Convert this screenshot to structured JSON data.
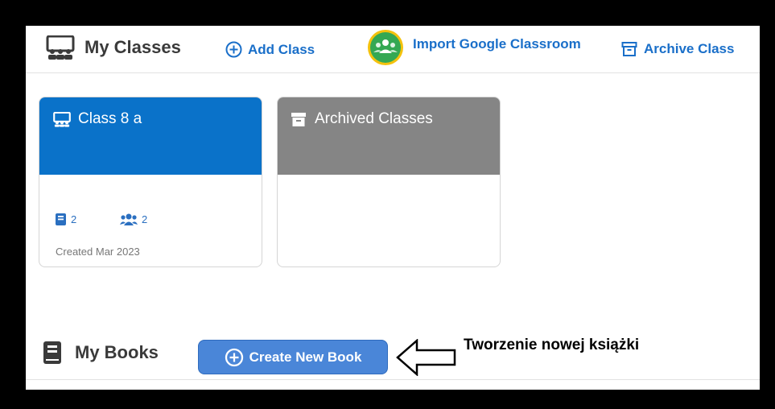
{
  "header": {
    "title": "My Classes",
    "add_class": "Add Class",
    "import_google": "Import Google Classroom",
    "archive_class": "Archive Class"
  },
  "cards": [
    {
      "title": "Class 8 a",
      "books_count": "2",
      "students_count": "2",
      "created": "Created Mar 2023",
      "color": "#0a72c9"
    },
    {
      "title": "Archived Classes",
      "color": "#858585"
    }
  ],
  "books": {
    "title": "My Books",
    "create_button": "Create New Book"
  },
  "annotation": {
    "text": "Tworzenie nowej książki"
  },
  "colors": {
    "accent": "#1a6fc9",
    "google_green": "#34a853",
    "google_ring": "#f4c20d",
    "button_blue": "#4a86d8"
  }
}
